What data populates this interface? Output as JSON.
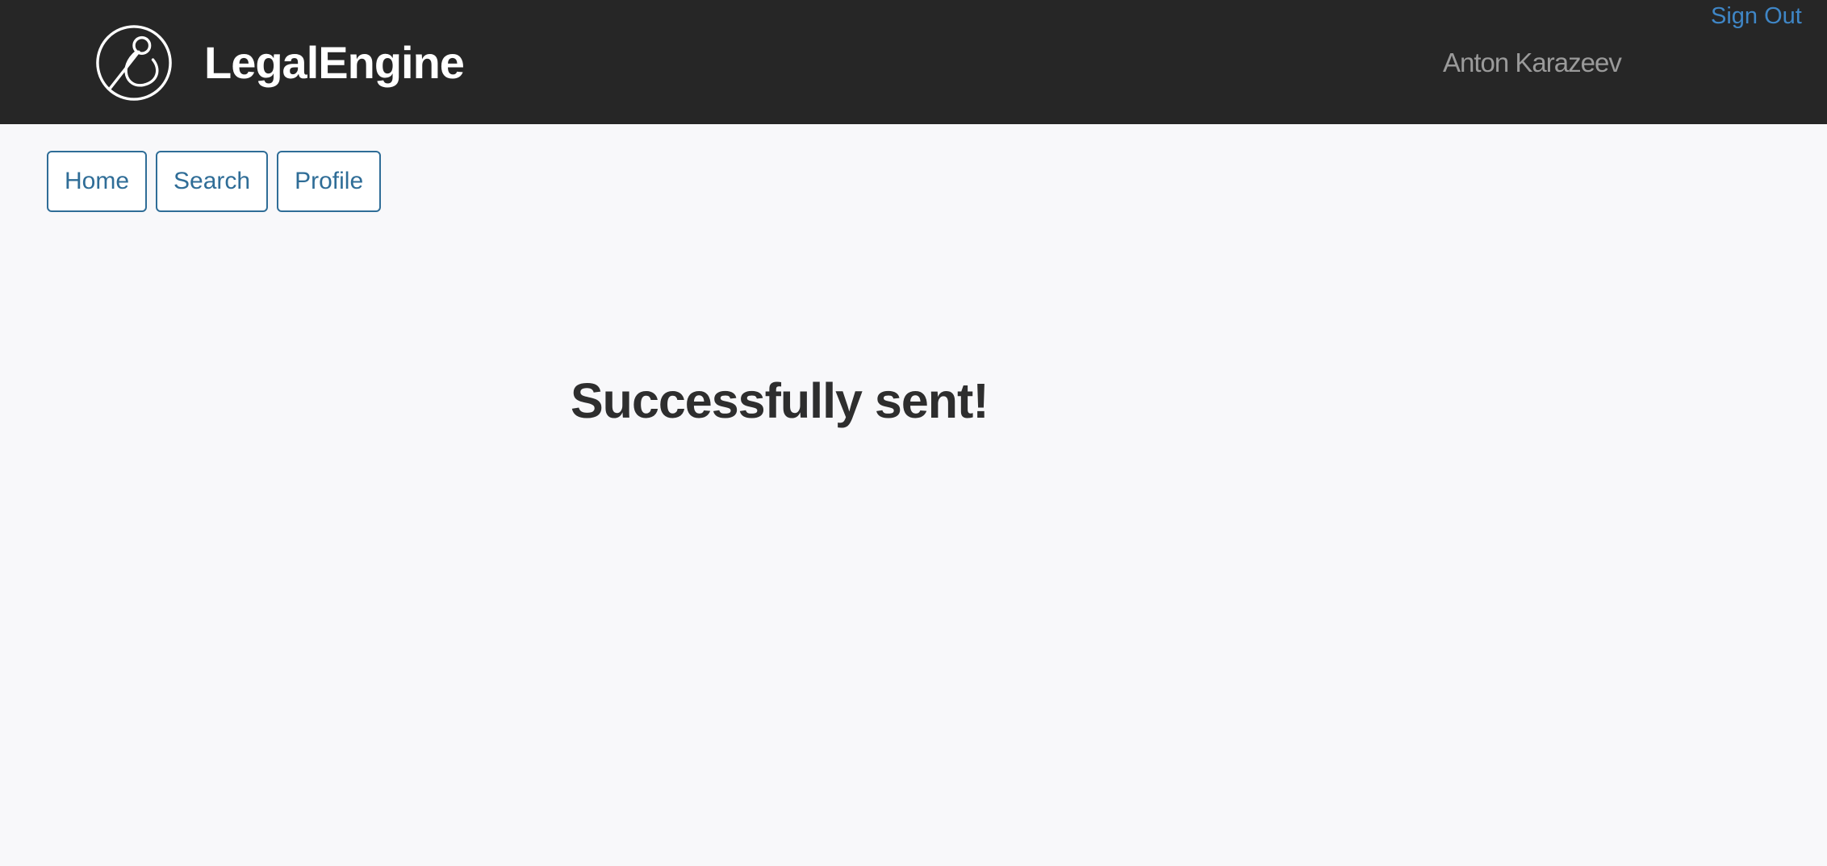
{
  "header": {
    "brand": "LegalEngine",
    "logo_icon": "legalengine-logo-icon",
    "user_name": "Anton Karazeev",
    "sign_out_label": "Sign Out"
  },
  "nav": {
    "items": [
      {
        "label": "Home"
      },
      {
        "label": "Search"
      },
      {
        "label": "Profile"
      }
    ]
  },
  "main": {
    "message": "Successfully sent!"
  },
  "colors": {
    "header_bg": "#262626",
    "page_bg": "#f8f8fa",
    "link": "#3f86c6",
    "nav_accent": "#2f6d97",
    "message_text": "#2e2e2e"
  }
}
